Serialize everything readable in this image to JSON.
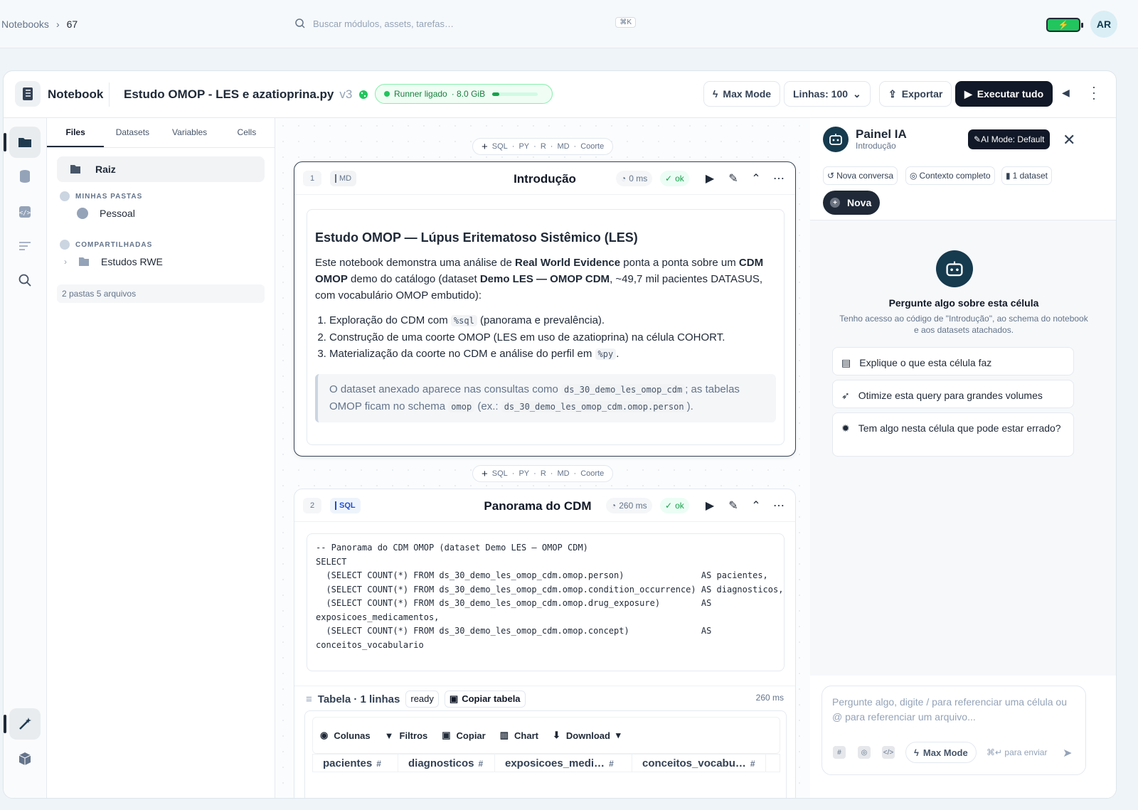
{
  "topbar": {
    "breadcrumb": [
      "Notebooks",
      "67"
    ],
    "search_placeholder": "Buscar módulos, assets, tarefas…",
    "search_shortcut": "⌘K",
    "user_initials": "AR"
  },
  "header": {
    "section": "Notebook",
    "title": "Estudo OMOP - LES e azatioprina.py",
    "version": "v3",
    "runner": {
      "label": "Runner ligado",
      "memory": "· 8.0 GiB",
      "usage_fraction": 0.15
    },
    "max_mode": "Max Mode",
    "lines": "Linhas: 100",
    "export": "Exportar",
    "run_all": "Executar tudo"
  },
  "files": {
    "tabs": [
      "Files",
      "Datasets",
      "Variables",
      "Cells"
    ],
    "root": "Raiz",
    "my_folders": "MINHAS PASTAS",
    "personal": "Pessoal",
    "shared": "COMPARTILHADAS",
    "shared_folder": "Estudos RWE",
    "counts": "2 pastas   5 arquivos"
  },
  "inserter": {
    "types": [
      "SQL",
      "PY",
      "R",
      "MD",
      "Coorte"
    ]
  },
  "cells": [
    {
      "num": "1",
      "type": "MD",
      "title": "Introdução",
      "time": "0 ms",
      "status": "ok",
      "heading": "Estudo OMOP — Lúpus Eritematoso Sistêmico (LES)",
      "p1": "Este notebook demonstra uma análise de ",
      "p1_b1": "Real World Evidence",
      "p1_2": " ponta a ponta sobre um ",
      "p1_b2": "CDM OMOP",
      "p1_3": " demo do catálogo (dataset ",
      "p1_b3": "Demo LES — OMOP CDM",
      "p1_4": ", ~49,7 mil pacientes DATASUS, com vocabulário OMOP embutido):",
      "li1a": "Exploração do CDM com ",
      "li1code": "%sql",
      "li1b": " (panorama e prevalência).",
      "li2": "Construção de uma coorte OMOP (LES em uso de azatioprina) na célula COHORT.",
      "li3a": "Materialização da coorte no CDM e análise do perfil em ",
      "li3code": "%py",
      "li3b": ".",
      "q1": "O dataset anexado aparece nas consultas como ",
      "qc1": "ds_30_demo_les_omop_cdm",
      "q2": "; as tabelas OMOP ficam no schema ",
      "qc2": "omop",
      "q3": " (ex.: ",
      "qc3": "ds_30_demo_les_omop_cdm.omop.person",
      "q4": ")."
    },
    {
      "num": "2",
      "type": "SQL",
      "title": "Panorama do CDM",
      "time": "260 ms",
      "status": "ok",
      "code": "-- Panorama do CDM OMOP (dataset Demo LES — OMOP CDM)\nSELECT\n  (SELECT COUNT(*) FROM ds_30_demo_les_omop_cdm.omop.person)               AS pacientes,\n  (SELECT COUNT(*) FROM ds_30_demo_les_omop_cdm.omop.condition_occurrence) AS diagnosticos,\n  (SELECT COUNT(*) FROM ds_30_demo_les_omop_cdm.omop.drug_exposure)        AS\nexposicoes_medicamentos,\n  (SELECT COUNT(*) FROM ds_30_demo_les_omop_cdm.omop.concept)              AS\nconceitos_vocabulario",
      "result": {
        "title": "Tabela · 1 linhas",
        "state": "ready",
        "copy": "Copiar tabela",
        "time": "260 ms",
        "tools": [
          "Colunas",
          "Filtros",
          "Copiar",
          "Chart",
          "Download"
        ],
        "columns": [
          "pacientes",
          "diagnosticos",
          "exposicoes_medi…",
          "conceitos_vocabu…"
        ],
        "col_type": "#"
      }
    }
  ],
  "ai": {
    "title": "Painel IA",
    "subtitle": "Introdução",
    "mode": "AI Mode: Default",
    "chips": [
      "Nova conversa",
      "Contexto completo",
      "1 dataset"
    ],
    "new": "Nova",
    "ask_title": "Pergunte algo sobre esta célula",
    "ask_desc": "Tenho acesso ao código de \"Introdução\", ao schema do notebook e aos datasets atachados.",
    "suggestions": [
      "Explique o que esta célula faz",
      "Otimize esta query para grandes volumes",
      "Tem algo nesta célula que pode estar errado?"
    ],
    "composer_placeholder": "Pergunte algo, digite / para referenciar uma célula ou @ para referenciar um arquivo...",
    "max_mode": "Max Mode",
    "send_hint": "para enviar"
  },
  "colors": {
    "accent": "#163a4e",
    "ok": "#16a34a",
    "dark": "#111827"
  }
}
